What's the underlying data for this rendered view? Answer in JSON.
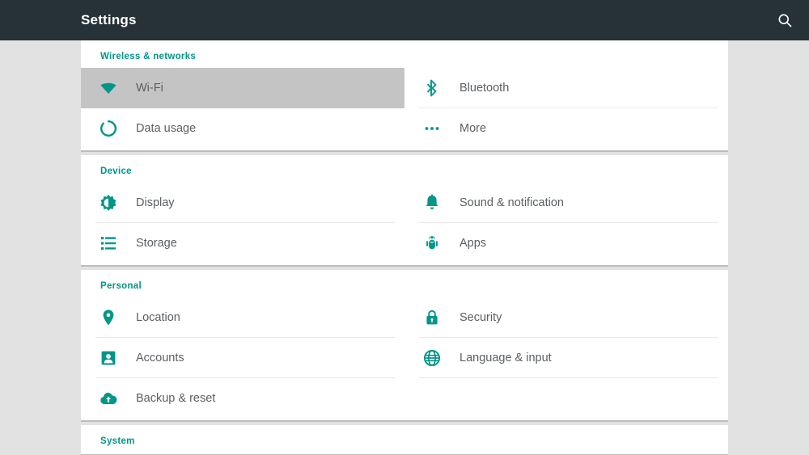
{
  "appbar": {
    "title": "Settings",
    "search_icon": "search-icon",
    "background": "#263238"
  },
  "theme": {
    "accent": "#009688",
    "page_background": "#e2e2e2",
    "card_background": "#ffffff",
    "label_color": "#5a5f63",
    "selection_background": "#c4c4c4"
  },
  "sections": [
    {
      "id": "wireless-and-networks",
      "title": "Wireless & networks",
      "rows": [
        [
          {
            "label": "Wi-Fi",
            "icon": "wifi-icon",
            "selected": true
          },
          {
            "label": "Bluetooth",
            "icon": "bluetooth-icon",
            "selected": false
          }
        ],
        [
          {
            "label": "Data usage",
            "icon": "data-usage-icon",
            "selected": false
          },
          {
            "label": "More",
            "icon": "more-horizontal-icon",
            "selected": false
          }
        ]
      ]
    },
    {
      "id": "device",
      "title": "Device",
      "rows": [
        [
          {
            "label": "Display",
            "icon": "brightness-icon",
            "selected": false
          },
          {
            "label": "Sound & notification",
            "icon": "bell-icon",
            "selected": false
          }
        ],
        [
          {
            "label": "Storage",
            "icon": "storage-list-icon",
            "selected": false
          },
          {
            "label": "Apps",
            "icon": "android-robot-icon",
            "selected": false
          }
        ]
      ]
    },
    {
      "id": "personal",
      "title": "Personal",
      "rows": [
        [
          {
            "label": "Location",
            "icon": "location-pin-icon",
            "selected": false
          },
          {
            "label": "Security",
            "icon": "lock-icon",
            "selected": false
          }
        ],
        [
          {
            "label": "Accounts",
            "icon": "account-card-icon",
            "selected": false
          },
          {
            "label": "Language & input",
            "icon": "globe-icon",
            "selected": false
          }
        ],
        [
          {
            "label": "Backup & reset",
            "icon": "cloud-upload-icon",
            "selected": false
          },
          {
            "label": "",
            "icon": "",
            "selected": false
          }
        ]
      ]
    },
    {
      "id": "system",
      "title": "System",
      "rows": []
    }
  ]
}
